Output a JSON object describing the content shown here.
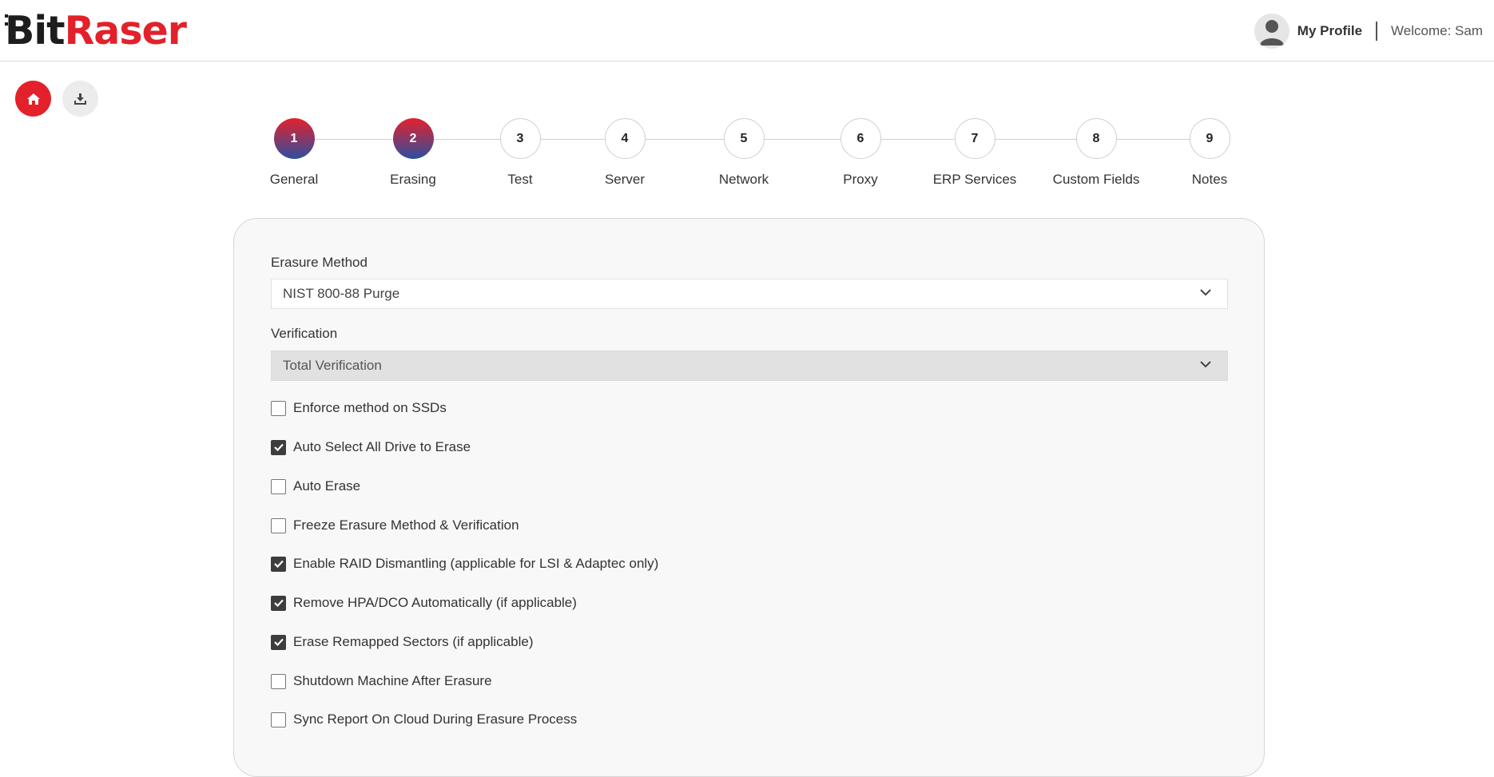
{
  "header": {
    "logo_left": "Bit",
    "logo_right": "Raser",
    "profile_label": "My Profile",
    "welcome": "Welcome: Sam"
  },
  "colors": {
    "brand_red": "#e3212b",
    "brand_blue": "#2c4f9e",
    "checkbox_checked": "#3d3d3d"
  },
  "actions": {
    "home_icon": "home-icon",
    "download_icon": "download-icon"
  },
  "steps": [
    {
      "number": "1",
      "label": "General",
      "completed": true
    },
    {
      "number": "2",
      "label": "Erasing",
      "completed": true
    },
    {
      "number": "3",
      "label": "Test",
      "completed": false
    },
    {
      "number": "4",
      "label": "Server",
      "completed": false
    },
    {
      "number": "5",
      "label": "Network",
      "completed": false
    },
    {
      "number": "6",
      "label": "Proxy",
      "completed": false
    },
    {
      "number": "7",
      "label": "ERP Services",
      "completed": false
    },
    {
      "number": "8",
      "label": "Custom Fields",
      "completed": false
    },
    {
      "number": "9",
      "label": "Notes",
      "completed": false
    }
  ],
  "form": {
    "erasure_method_label": "Erasure Method",
    "erasure_method_value": "NIST 800-88 Purge",
    "verification_label": "Verification",
    "verification_value": "Total Verification",
    "options": [
      {
        "label": "Enforce method on SSDs",
        "checked": false
      },
      {
        "label": "Auto Select All Drive to Erase",
        "checked": true
      },
      {
        "label": "Auto Erase",
        "checked": false
      },
      {
        "label": "Freeze Erasure Method & Verification",
        "checked": false
      },
      {
        "label": "Enable RAID Dismantling (applicable for LSI & Adaptec only)",
        "checked": true
      },
      {
        "label": "Remove HPA/DCO Automatically (if applicable)",
        "checked": true
      },
      {
        "label": "Erase Remapped Sectors (if applicable)",
        "checked": true
      },
      {
        "label": "Shutdown Machine After Erasure",
        "checked": false
      },
      {
        "label": "Sync Report On Cloud During Erasure Process",
        "checked": false
      }
    ]
  }
}
